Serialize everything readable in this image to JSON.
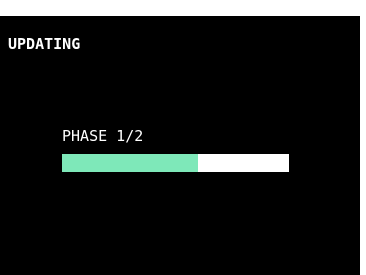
{
  "screen": {
    "title": "UPDATING",
    "phase_label": "PHASE 1/2",
    "progress_fraction": 0.6,
    "colors": {
      "background": "#000000",
      "text": "#ffffff",
      "progress_fill": "#7ee8b9",
      "progress_track": "#ffffff"
    }
  }
}
